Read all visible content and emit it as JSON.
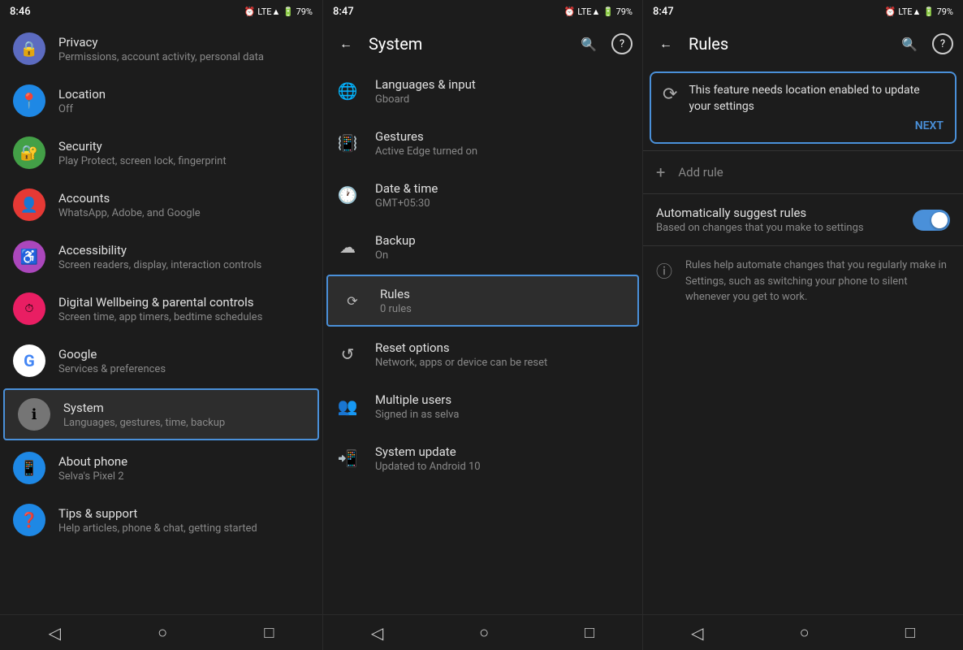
{
  "panel1": {
    "statusBar": {
      "time": "8:46",
      "icons": "⏰ LTE▲ 🔋 79%"
    },
    "items": [
      {
        "id": "privacy",
        "icon": "🔒",
        "iconBg": "ic-privacy",
        "title": "Privacy",
        "subtitle": "Permissions, account activity, personal data"
      },
      {
        "id": "location",
        "icon": "📍",
        "iconBg": "ic-location",
        "title": "Location",
        "subtitle": "Off"
      },
      {
        "id": "security",
        "icon": "🔐",
        "iconBg": "ic-security",
        "title": "Security",
        "subtitle": "Play Protect, screen lock, fingerprint"
      },
      {
        "id": "accounts",
        "icon": "👤",
        "iconBg": "ic-accounts",
        "title": "Accounts",
        "subtitle": "WhatsApp, Adobe, and Google"
      },
      {
        "id": "access",
        "icon": "♿",
        "iconBg": "ic-access",
        "title": "Accessibility",
        "subtitle": "Screen readers, display, interaction controls"
      },
      {
        "id": "wellbeing",
        "icon": "⏱",
        "iconBg": "ic-wellbeing",
        "title": "Digital Wellbeing & parental controls",
        "subtitle": "Screen time, app timers, bedtime schedules"
      },
      {
        "id": "google",
        "icon": "G",
        "iconBg": "ic-google",
        "title": "Google",
        "subtitle": "Services & preferences"
      },
      {
        "id": "system",
        "icon": "ℹ",
        "iconBg": "ic-system",
        "title": "System",
        "subtitle": "Languages, gestures, time, backup",
        "selected": true
      },
      {
        "id": "about",
        "icon": "📱",
        "iconBg": "ic-about",
        "title": "About phone",
        "subtitle": "Selva's Pixel 2"
      },
      {
        "id": "tips",
        "icon": "❓",
        "iconBg": "ic-tips",
        "title": "Tips & support",
        "subtitle": "Help articles, phone & chat, getting started"
      }
    ],
    "navBar": {
      "back": "◁",
      "home": "○",
      "recents": "□"
    }
  },
  "panel2": {
    "statusBar": {
      "time": "8:47",
      "icons": "⏰ LTE▲ 🔋 79%"
    },
    "appBar": {
      "title": "System",
      "backIcon": "←",
      "searchIcon": "🔍",
      "helpIcon": "?"
    },
    "menuItems": [
      {
        "id": "languages",
        "icon": "🌐",
        "title": "Languages & input",
        "subtitle": "Gboard"
      },
      {
        "id": "gestures",
        "icon": "📳",
        "title": "Gestures",
        "subtitle": "Active Edge turned on"
      },
      {
        "id": "datetime",
        "icon": "🕐",
        "title": "Date & time",
        "subtitle": "GMT+05:30"
      },
      {
        "id": "backup",
        "icon": "☁",
        "title": "Backup",
        "subtitle": "On"
      },
      {
        "id": "rules",
        "icon": "⟳",
        "title": "Rules",
        "subtitle": "0 rules",
        "selected": true
      },
      {
        "id": "reset",
        "icon": "↺",
        "title": "Reset options",
        "subtitle": "Network, apps or device can be reset"
      },
      {
        "id": "multiuser",
        "icon": "👥",
        "title": "Multiple users",
        "subtitle": "Signed in as selva"
      },
      {
        "id": "update",
        "icon": "📲",
        "title": "System update",
        "subtitle": "Updated to Android 10"
      }
    ],
    "navBar": {
      "back": "◁",
      "home": "○",
      "recents": "□"
    }
  },
  "panel3": {
    "statusBar": {
      "time": "8:47",
      "icons": "⏰ LTE▲ 🔋 79%"
    },
    "appBar": {
      "title": "Rules",
      "backIcon": "←",
      "searchIcon": "🔍",
      "helpIcon": "?"
    },
    "notice": {
      "icon": "⟳",
      "message": "This feature needs location enabled to update your settings",
      "nextLabel": "NEXT"
    },
    "addRule": {
      "icon": "+",
      "label": "Add rule"
    },
    "suggest": {
      "title": "Automatically suggest rules",
      "subtitle": "Based on changes that you make to settings",
      "toggleOn": true
    },
    "infoText": "Rules help automate changes that you regularly make in Settings, such as switching your phone to silent whenever you get to work.",
    "navBar": {
      "back": "◁",
      "home": "○",
      "recents": "□"
    }
  }
}
